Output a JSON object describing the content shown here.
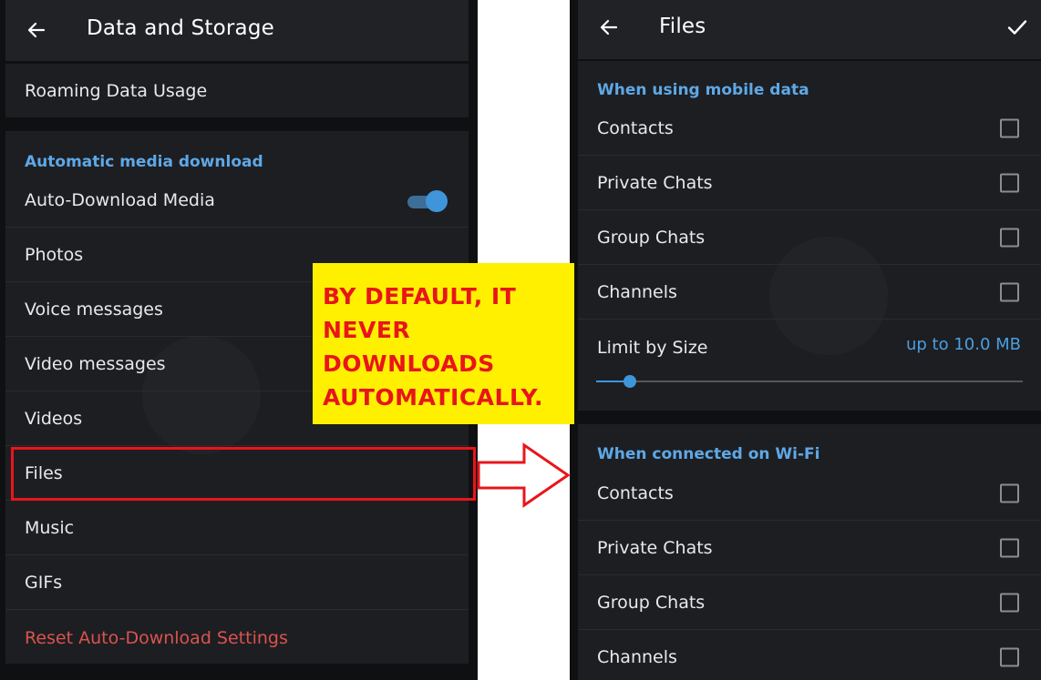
{
  "left_screen": {
    "title": "Data and Storage",
    "roaming_label": "Roaming Data Usage",
    "section_title": "Automatic media download",
    "auto_download_label": "Auto-Download Media",
    "auto_download_enabled": true,
    "items": [
      "Photos",
      "Voice messages",
      "Video messages",
      "Videos",
      "Files",
      "Music",
      "GIFs"
    ],
    "reset_label": "Reset Auto-Download Settings"
  },
  "right_screen": {
    "title": "Files",
    "mobile_section": "When using mobile data",
    "mobile_items": [
      "Contacts",
      "Private Chats",
      "Group Chats",
      "Channels"
    ],
    "limit_label": "Limit by Size",
    "limit_value": "up to 10.0 MB",
    "limit_fraction": 0.08,
    "wifi_section": "When connected on Wi-Fi",
    "wifi_items": [
      "Contacts",
      "Private Chats",
      "Group Chats",
      "Channels"
    ]
  },
  "annotation": {
    "callout_lines": [
      "BY DEFAULT, IT",
      "NEVER",
      "DOWNLOADS",
      "AUTOMATICALLY."
    ]
  },
  "colors": {
    "accent": "#3f95da",
    "section_header": "#5ea8e6",
    "reset": "#d9534f",
    "callout_bg": "#fff000",
    "callout_text": "#e8151b",
    "highlight": "#e8151b"
  }
}
